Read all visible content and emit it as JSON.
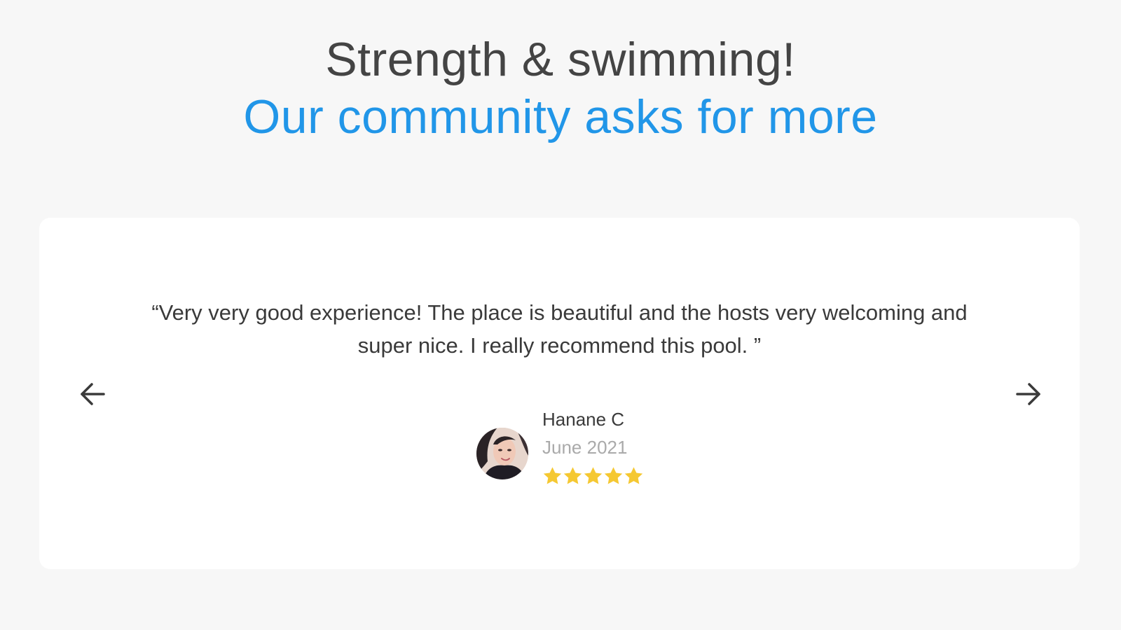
{
  "heading": {
    "line1": "Strength & swimming!",
    "line2": "Our community asks for more"
  },
  "colors": {
    "accent": "#2196e8",
    "text": "#444444",
    "muted": "#aaaaaa",
    "star": "#f5c832",
    "background": "#f7f7f7",
    "card": "#ffffff"
  },
  "review": {
    "quote": "“Very very good experience! The place is beautiful and the hosts very welcoming and super nice. I really recommend this pool. ”",
    "author": "Hanane C",
    "date": "June 2021",
    "rating": 5,
    "rating_max": 5
  },
  "controls": {
    "prev_icon": "arrow-left-icon",
    "next_icon": "arrow-right-icon"
  }
}
